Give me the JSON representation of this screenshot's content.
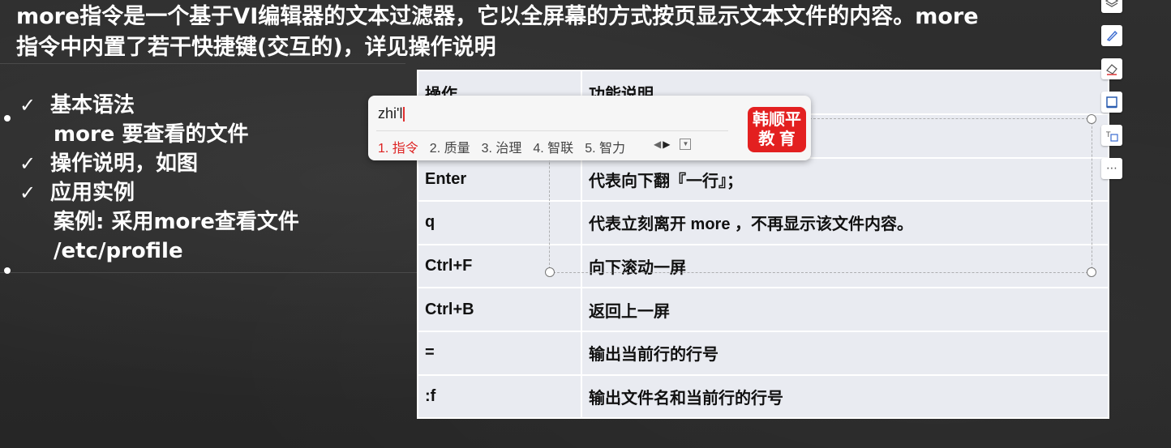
{
  "intro": {
    "line1": "more指令是一个基于VI编辑器的文本过滤器，它以全屏幕的方式按页显示文本文件的内容。more",
    "line2": "指令中内置了若干快捷键(交互的)，详见操作说明"
  },
  "bullets": [
    {
      "label": "基本语法"
    },
    {
      "label": "操作说明，如图"
    },
    {
      "label": "应用实例"
    }
  ],
  "syntax": "more 要查看的文件",
  "example": {
    "line1": "案例: 采用more查看文件",
    "line2": "/etc/profile"
  },
  "table": {
    "headers": [
      "操作",
      "功能说明"
    ],
    "rows": [
      [
        "",
        ""
      ],
      [
        "Enter",
        "代表向下翻『一行』；"
      ],
      [
        "q",
        "代表立刻离开 more ，不再显示该文件内容。"
      ],
      [
        "Ctrl+F",
        "向下滚动一屏"
      ],
      [
        "Ctrl+B",
        "返回上一屏"
      ],
      [
        "=",
        "输出当前行的行号"
      ],
      [
        ":f",
        "输出文件名和当前行的行号"
      ]
    ]
  },
  "ime": {
    "input": "zhi'l",
    "candidates": [
      "1. 指令",
      "2. 质量",
      "3. 治理",
      "4. 智联",
      "5. 智力"
    ],
    "logo_line1": "韩顺平",
    "logo_line2": "教 育"
  },
  "rail_icons": [
    "layers-icon",
    "pen-icon",
    "eraser-icon",
    "frame-icon",
    "text-box-icon",
    "more-icon"
  ]
}
